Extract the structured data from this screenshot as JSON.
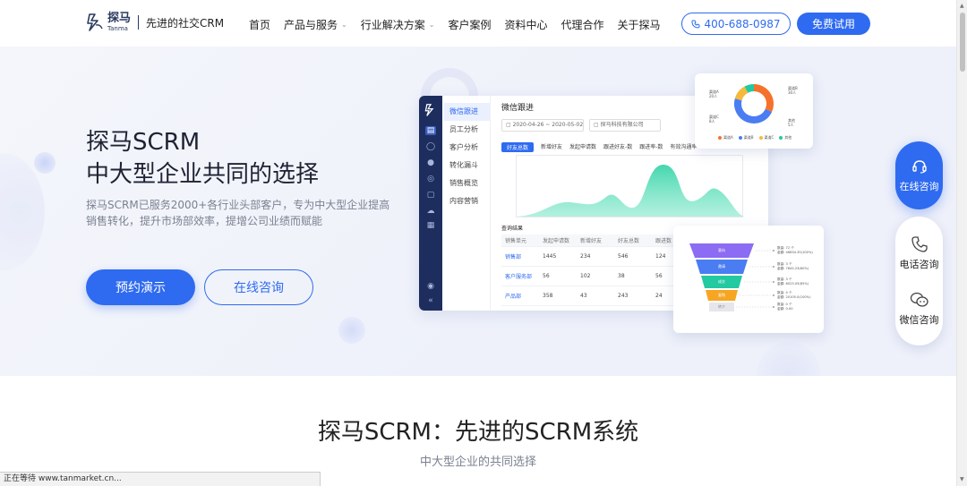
{
  "nav": {
    "logo_cn": "探马",
    "logo_en": "Tanma",
    "slogan": "先进的社交CRM",
    "menu": [
      {
        "label": "首页",
        "dropdown": false
      },
      {
        "label": "产品与服务",
        "dropdown": true
      },
      {
        "label": "行业解决方案",
        "dropdown": true
      },
      {
        "label": "客户案例",
        "dropdown": false
      },
      {
        "label": "资料中心",
        "dropdown": false
      },
      {
        "label": "代理合作",
        "dropdown": false
      },
      {
        "label": "关于探马",
        "dropdown": false
      }
    ],
    "phone": "400-688-0987",
    "trial": "免费试用"
  },
  "hero": {
    "title_line1": "探马SCRM",
    "title_line2": "中大型企业共同的选择",
    "desc": "探马SCRM已服务2000+各行业头部客户，专为中大型企业提高销售转化，提升市场部效率，提增公司业绩而赋能",
    "btn_demo": "预约演示",
    "btn_consult": "在线咨询"
  },
  "dashboard": {
    "menu": [
      "微信跟进",
      "员工分析",
      "客户分析",
      "转化漏斗",
      "销售概览",
      "内容营销"
    ],
    "header": "微信跟进",
    "date_range": "2020-04-26 ~ 2020-05-02",
    "company": "探马科技有限公司",
    "tabs": [
      "好友总数",
      "新增好友",
      "发起申请数",
      "跟进好友-数",
      "跟进率-数",
      "有效沟通率-%"
    ],
    "table_title": "查询结果",
    "table_head": [
      "销售单元",
      "发起申请数",
      "新增好友",
      "好友总数",
      "跟进数"
    ],
    "table_rows": [
      [
        "销售部",
        "1445",
        "234",
        "546",
        "124"
      ],
      [
        "客户服务部",
        "56",
        "102",
        "38",
        "56"
      ],
      [
        "产品部",
        "358",
        "43",
        "243",
        "24"
      ]
    ]
  },
  "donut": {
    "labels": [
      {
        "t1": "渠道A",
        "t2": "20人"
      },
      {
        "t1": "渠道B",
        "t2": "30人"
      },
      {
        "t1": "渠道C",
        "t2": "8人"
      },
      {
        "t1": "其他",
        "t2": "5人"
      }
    ],
    "legend": [
      "渠道A",
      "渠道B",
      "渠道C",
      "其他"
    ],
    "colors": [
      "#f5722c",
      "#4a7cf2",
      "#f6b93b",
      "#23c9a0"
    ],
    "values": [
      20,
      30,
      8,
      5
    ]
  },
  "funnel": {
    "stages": [
      "意向",
      "邀请",
      "成交",
      "复购",
      "转介"
    ],
    "colors": [
      "#8b6cf2",
      "#4a7cf2",
      "#23c9a0",
      "#f6a623",
      "#e9e9ee"
    ],
    "annotations": [
      {
        "a": "数量: 72 个",
        "b": "金额: 46834.35(100%)"
      },
      {
        "a": "数量: 3 个",
        "b": "金额: 7845.23(60%)"
      },
      {
        "a": "数量: 3 个",
        "b": "金额: 6023.05(85%)"
      },
      {
        "a": "数量: 4 个",
        "b": "金额: 20105.0(100%)"
      },
      {
        "a": "数量: 0 个",
        "b": "金额: 0.00"
      }
    ]
  },
  "float": {
    "online": "在线咨询",
    "phone": "电话咨询",
    "wechat": "微信咨询"
  },
  "section": {
    "title": "探马SCRM：先进的SCRM系统",
    "subtitle": "中大型企业的共同选择"
  },
  "status": "正在等待 www.tanmarket.cn..."
}
